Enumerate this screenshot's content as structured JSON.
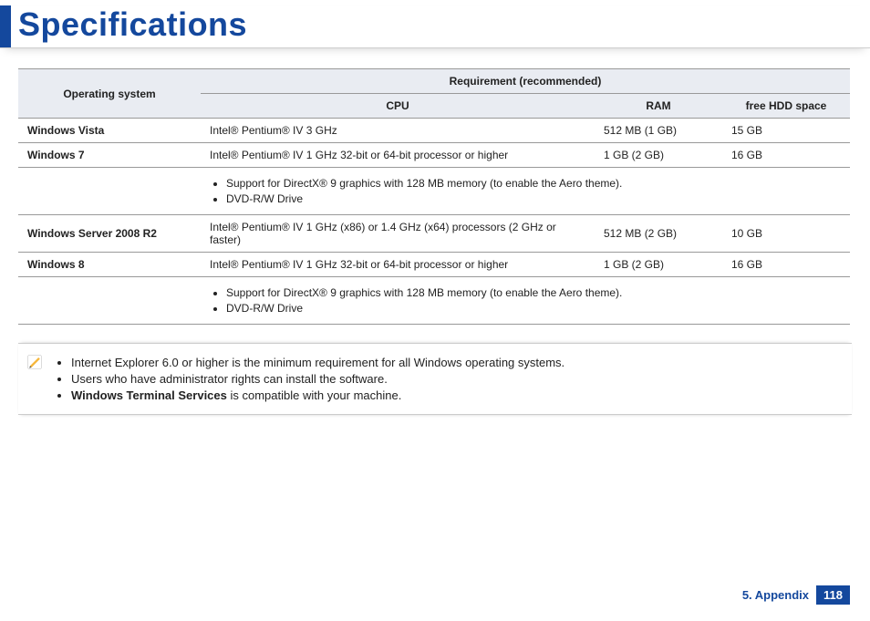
{
  "title": "Specifications",
  "table": {
    "header": {
      "os": "Operating system",
      "req": "Requirement (recommended)",
      "cpu": "CPU",
      "ram": "RAM",
      "hdd": "free HDD space"
    },
    "rows": {
      "vista": {
        "os": "Windows Vista",
        "cpu": "Intel® Pentium® IV 3 GHz",
        "ram": "512 MB (1 GB)",
        "hdd": "15 GB"
      },
      "win7": {
        "os": "Windows   7",
        "cpu": "Intel® Pentium® IV 1 GHz 32-bit or 64-bit processor or higher",
        "ram": "1 GB (2 GB)",
        "hdd": "16 GB"
      },
      "win7_notes": [
        "Support for DirectX® 9 graphics with 128 MB memory (to enable the Aero theme).",
        "DVD-R/W Drive"
      ],
      "srv2008": {
        "os": "Windows Server   2008 R2",
        "cpu": "Intel® Pentium® IV 1 GHz (x86) or 1.4 GHz (x64) processors (2 GHz or faster)",
        "ram": "512 MB (2 GB)",
        "hdd": "10 GB"
      },
      "win8": {
        "os": "Windows   8",
        "cpu": "Intel® Pentium® IV 1 GHz 32-bit or 64-bit processor or higher",
        "ram": "1 GB (2 GB)",
        "hdd": "16 GB"
      },
      "win8_notes": [
        "Support for DirectX® 9 graphics with 128 MB memory (to enable the Aero theme).",
        "DVD-R/W Drive"
      ]
    }
  },
  "notes": {
    "n1": "Internet Explorer 6.0 or higher is the minimum requirement for all Windows operating systems.",
    "n2": "Users who have administrator rights can install the software.",
    "n3_bold": "Windows Terminal Services",
    "n3_rest": " is compatible with your machine."
  },
  "footer": {
    "section": "5. Appendix",
    "page": "118"
  }
}
